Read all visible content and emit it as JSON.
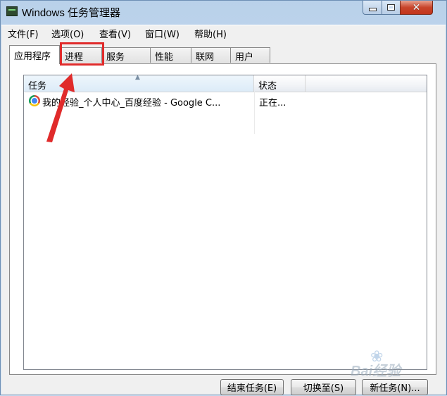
{
  "window": {
    "title": "Windows 任务管理器",
    "controls": {
      "minimize": "–",
      "maximize": "□",
      "close": "✕"
    }
  },
  "menubar": {
    "items": [
      {
        "label": "文件(F)"
      },
      {
        "label": "选项(O)"
      },
      {
        "label": "查看(V)"
      },
      {
        "label": "窗口(W)"
      },
      {
        "label": "帮助(H)"
      }
    ]
  },
  "tabs": {
    "active": "应用程序",
    "items": [
      {
        "label": "应用程序"
      },
      {
        "label": "进程"
      },
      {
        "label": "服务"
      },
      {
        "label": "性能"
      },
      {
        "label": "联网"
      },
      {
        "label": "用户"
      }
    ]
  },
  "listview": {
    "columns": [
      {
        "label": "任务"
      },
      {
        "label": "状态"
      }
    ],
    "sort_indicator": "▲",
    "rows": [
      {
        "task": "我的经验_个人中心_百度经验 - Google C...",
        "status": "正在..."
      }
    ]
  },
  "buttons": {
    "end_task": "结束任务(E)",
    "switch_to": "切换至(S)",
    "new_task": "新任务(N)..."
  },
  "annotation": {
    "color": "#e02b2b"
  },
  "watermark": {
    "text": "Bai经验",
    "paw": "❀"
  },
  "colors": {
    "title_bar": "#c9dcf0",
    "close_button": "#c8452b",
    "client_bg": "#f0f0f0"
  }
}
